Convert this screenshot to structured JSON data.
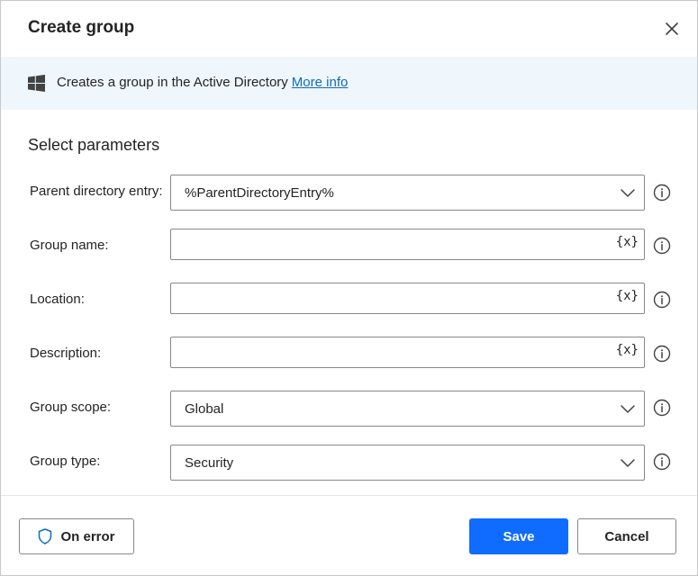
{
  "dialog": {
    "title": "Create group",
    "close_icon": "close-icon"
  },
  "banner": {
    "icon": "windows-logo-icon",
    "text": "Creates a group in the Active Directory",
    "link_label": "More info"
  },
  "section_title": "Select parameters",
  "fields": [
    {
      "label": "Parent directory entry:",
      "type": "select",
      "value": "%ParentDirectoryEntry%"
    },
    {
      "label": "Group name:",
      "type": "text",
      "value": "",
      "variable_button": "{x}"
    },
    {
      "label": "Location:",
      "type": "text",
      "value": "",
      "variable_button": "{x}"
    },
    {
      "label": "Description:",
      "type": "text",
      "value": "",
      "variable_button": "{x}"
    },
    {
      "label": "Group scope:",
      "type": "select",
      "value": "Global"
    },
    {
      "label": "Group type:",
      "type": "select",
      "value": "Security"
    }
  ],
  "footer": {
    "on_error_label": "On error",
    "save_label": "Save",
    "cancel_label": "Cancel"
  },
  "colors": {
    "accent": "#0f6cff",
    "link": "#0f6cbd",
    "banner_bg": "#eff6fc",
    "border": "#8a8886"
  }
}
